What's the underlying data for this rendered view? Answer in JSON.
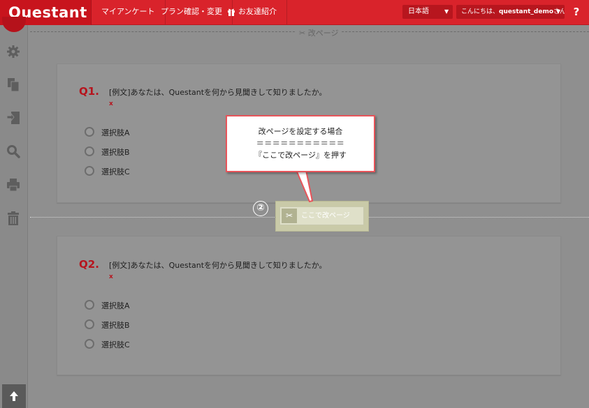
{
  "topbar": {
    "logo": "Questant",
    "nav": [
      "マイアンケート",
      "プラン確認・変更",
      "お友達紹介"
    ],
    "language": "日本語",
    "greeting_prefix": "こんにちは、",
    "username": "questant_demo",
    "greeting_suffix": "さん",
    "help": "?"
  },
  "page_break_label": "改ページ",
  "questions": [
    {
      "number": "Q1.",
      "text": "[例文]あなたは、Questantを何から見聞きして知りましたか。",
      "required": "x",
      "options": [
        "選択肢A",
        "選択肢B",
        "選択肢C"
      ]
    },
    {
      "number": "Q2.",
      "text": "[例文]あなたは、Questantを何から見聞きして知りましたか。",
      "required": "x",
      "options": [
        "選択肢A",
        "選択肢B",
        "選択肢C"
      ]
    }
  ],
  "page_break_button": {
    "label": "ここで改ページ"
  },
  "step_number": "②",
  "callout": {
    "line1": "改ページを設定する場合",
    "line2": "＝＝＝＝＝＝＝＝＝＝＝",
    "line3": "『ここで改ページ』を押す"
  },
  "colors": {
    "brand_red": "#d9232b",
    "callout_border": "#e8545a",
    "highlight": "#c9caa8"
  }
}
